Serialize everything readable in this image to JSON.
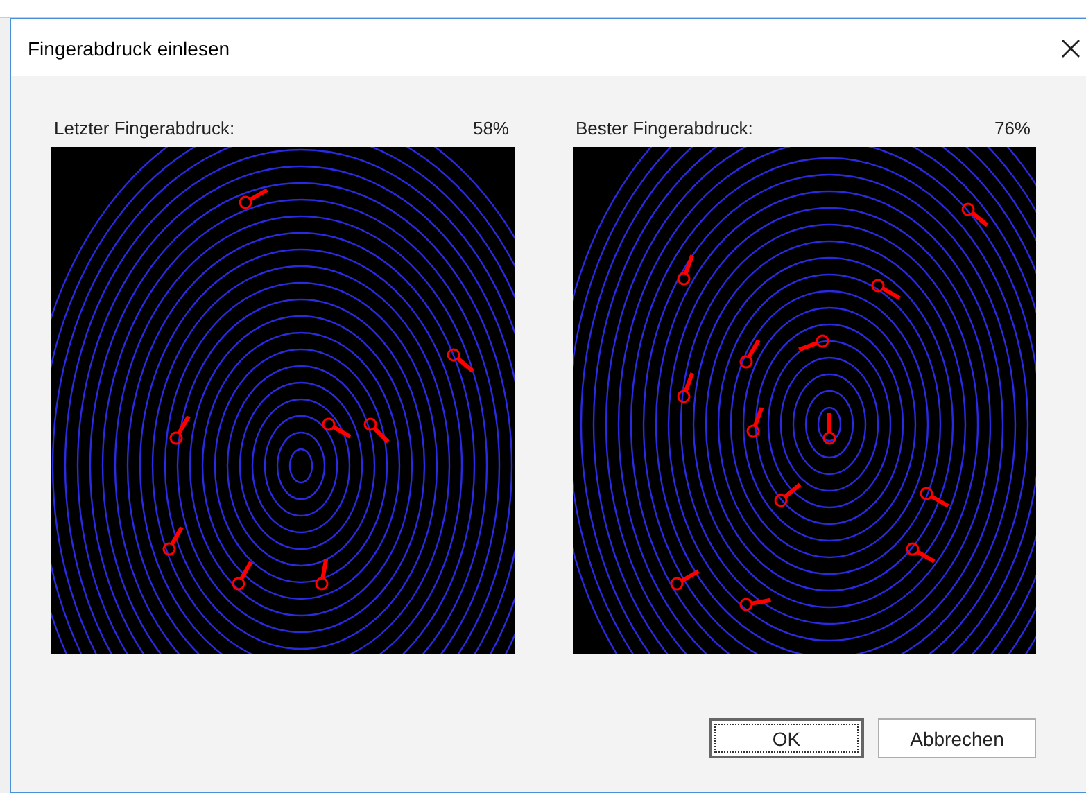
{
  "window": {
    "title": "Fingerabdruck einlesen"
  },
  "panels": [
    {
      "label": "Letzter Fingerabdruck:",
      "score": "58%"
    },
    {
      "label": "Bester Fingerabdruck:",
      "score": "76%"
    }
  ],
  "buttons": [
    {
      "label": "OK",
      "default": true
    },
    {
      "label": "Abbrechen",
      "default": false
    }
  ]
}
